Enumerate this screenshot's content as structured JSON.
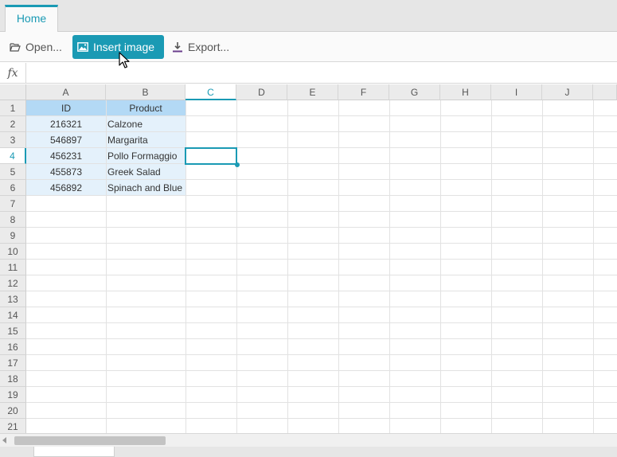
{
  "ribbon": {
    "tabs": [
      {
        "label": "Home"
      }
    ]
  },
  "toolbar": {
    "open_label": "Open...",
    "insert_image_label": "Insert image",
    "export_label": "Export..."
  },
  "formula_bar": {
    "fx_label": "fx",
    "value": ""
  },
  "columns": [
    "A",
    "B",
    "C",
    "D",
    "E",
    "F",
    "G",
    "H",
    "I",
    "J"
  ],
  "rows": [
    "1",
    "2",
    "3",
    "4",
    "5",
    "6",
    "7",
    "8",
    "9",
    "10",
    "11",
    "12",
    "13",
    "14",
    "15",
    "16",
    "17",
    "18",
    "19",
    "20",
    "21"
  ],
  "table": {
    "headers": [
      "ID",
      "Product"
    ],
    "rows": [
      [
        "216321",
        "Calzone"
      ],
      [
        "546897",
        "Margarita"
      ],
      [
        "456231",
        "Pollo Formaggio"
      ],
      [
        "455873",
        "Greek Salad"
      ],
      [
        "456892",
        "Spinach and Blue"
      ]
    ]
  },
  "selection": {
    "cell": "C4"
  },
  "sheet_tabs": [
    {
      "label": ""
    }
  ],
  "colors": {
    "accent": "#1a9ab4",
    "table_header": "#b3d9f5",
    "table_body": "#e4f1fb"
  }
}
